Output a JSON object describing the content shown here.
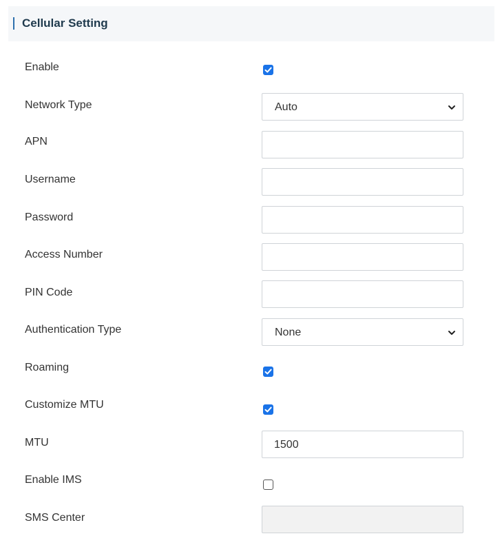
{
  "section": {
    "title": "Cellular Setting"
  },
  "fields": {
    "enable": {
      "label": "Enable",
      "checked": true
    },
    "network_type": {
      "label": "Network Type",
      "value": "Auto"
    },
    "apn": {
      "label": "APN",
      "value": ""
    },
    "username": {
      "label": "Username",
      "value": ""
    },
    "password": {
      "label": "Password",
      "value": ""
    },
    "access_number": {
      "label": "Access Number",
      "value": ""
    },
    "pin_code": {
      "label": "PIN Code",
      "value": ""
    },
    "authentication_type": {
      "label": "Authentication Type",
      "value": "None"
    },
    "roaming": {
      "label": "Roaming",
      "checked": true
    },
    "customize_mtu": {
      "label": "Customize MTU",
      "checked": true
    },
    "mtu": {
      "label": "MTU",
      "value": "1500"
    },
    "enable_ims": {
      "label": "Enable IMS",
      "checked": false
    },
    "sms_center": {
      "label": "SMS Center",
      "value": ""
    }
  },
  "colors": {
    "accent": "#1a73e8",
    "header_bar": "#2c6fad",
    "header_bg": "#f5f7f9",
    "field_border": "#cfd3d7"
  },
  "icons": {
    "checkbox_mark": "check-icon",
    "select_arrow": "chevron-down-icon"
  }
}
